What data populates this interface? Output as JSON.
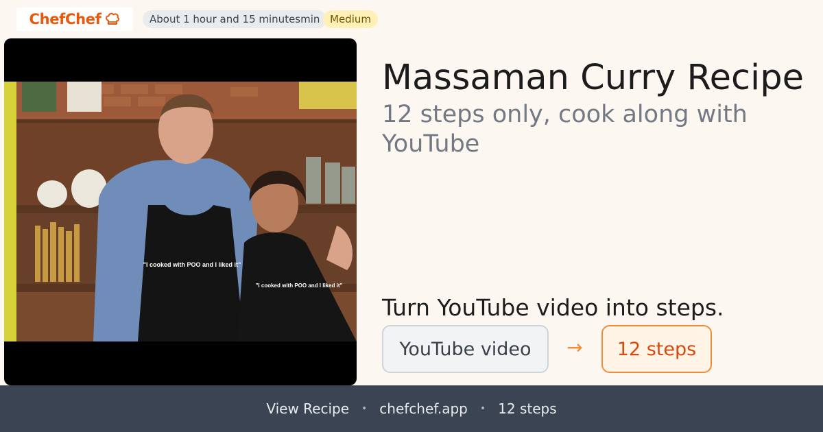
{
  "header": {
    "logo_text": "ChefChef",
    "time_label": "About 1 hour and 15 minutesmin",
    "difficulty_label": "Medium"
  },
  "video": {
    "apron_text_left": "\"I cooked with POO and I liked it\"",
    "apron_text_right": "\"I cooked with POO and I liked it\""
  },
  "recipe": {
    "title": "Massaman Curry Recipe",
    "subtitle": "12 steps only, cook along with YouTube",
    "tagline": "Turn YouTube video into steps.",
    "source_label": "YouTube video",
    "arrow": "→",
    "result_label": "12 steps"
  },
  "footer": {
    "link_label": "View Recipe",
    "domain": "chefchef.app",
    "steps_count": "12 steps",
    "separator": "•"
  },
  "colors": {
    "brand": "#e8590c",
    "background": "#fdf7f2",
    "footer_bg": "#3b4452",
    "accent_orange": "#f08c3a"
  },
  "icons": [
    "chef-hat-icon",
    "arrow-right-icon"
  ]
}
